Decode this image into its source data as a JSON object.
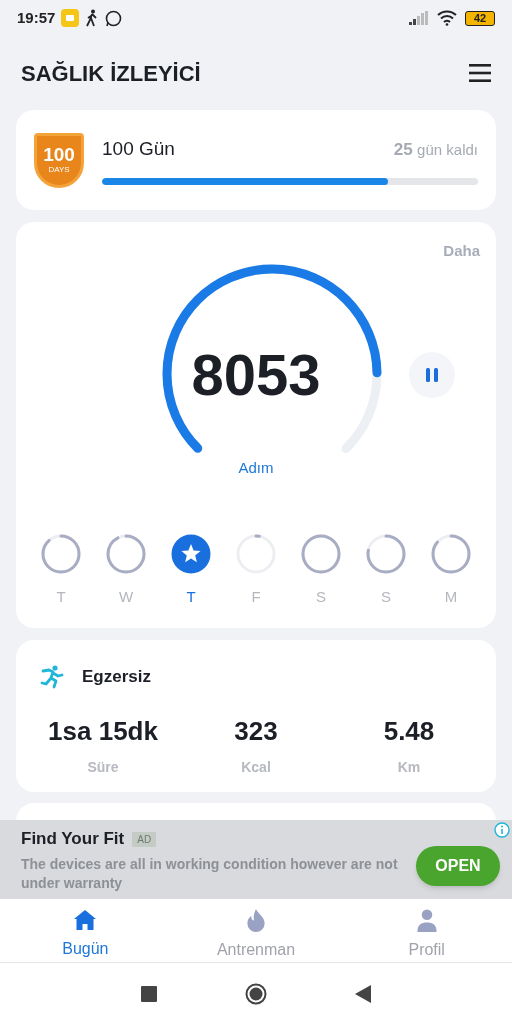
{
  "status_bar": {
    "time": "19:57",
    "battery": "42"
  },
  "header": {
    "title": "SAĞLIK İZLEYİCİ"
  },
  "challenge": {
    "badge_number": "100",
    "badge_label": "DAYS",
    "title": "100 Gün",
    "days_left": "25",
    "days_left_label": "gün kaldı",
    "level": 0.76
  },
  "steps": {
    "more": "Daha",
    "count": "8053",
    "unit": "Adım",
    "days": [
      {
        "label": "T",
        "selected": false
      },
      {
        "label": "W",
        "selected": false
      },
      {
        "label": "T",
        "selected": true
      },
      {
        "label": "F",
        "selected": false
      },
      {
        "label": "S",
        "selected": false
      },
      {
        "label": "S",
        "selected": false
      },
      {
        "label": "M",
        "selected": false
      }
    ]
  },
  "exercise": {
    "title": "Egzersiz",
    "stats": [
      {
        "value": "1sa 15dk",
        "label": "Süre"
      },
      {
        "value": "323",
        "label": "Kcal"
      },
      {
        "value": "5.48",
        "label": "Km"
      }
    ]
  },
  "ad": {
    "title": "Find Your Fit",
    "badge": "AD",
    "text": "The devices are all in working condition however are not under warranty",
    "button": "OPEN"
  },
  "tabs": [
    {
      "label": "Bugün",
      "selected": true
    },
    {
      "label": "Antrenman",
      "selected": false
    },
    {
      "label": "Profil",
      "selected": false
    }
  ]
}
